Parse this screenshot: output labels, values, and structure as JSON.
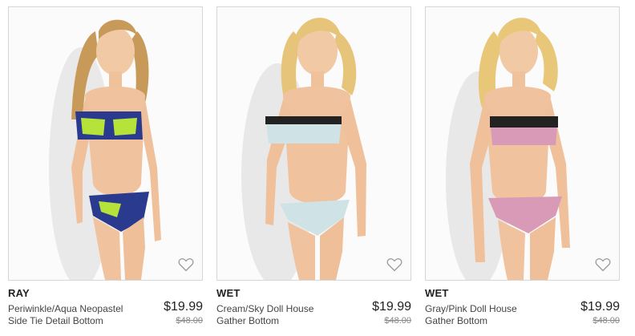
{
  "products": [
    {
      "brand": "RAY",
      "name": "Periwinkle/Aqua Neopastel Side Tie Detail Bottom",
      "price": "$19.99",
      "original_price": "$48.00",
      "hair_color": "#c89a5a",
      "swim_color": "#2a3a8f",
      "swim_accent": "#b6e33a"
    },
    {
      "brand": "WET",
      "name": "Cream/Sky Doll House Gather Bottom",
      "price": "$19.99",
      "original_price": "$48.00",
      "hair_color": "#e6c47a",
      "swim_color": "#cfe3e6",
      "swim_accent": "#222222"
    },
    {
      "brand": "WET",
      "name": "Gray/Pink Doll House Gather Bottom",
      "price": "$19.99",
      "original_price": "$48.00",
      "hair_color": "#e8c878",
      "swim_color": "#d99ab7",
      "swim_accent": "#222222"
    }
  ],
  "icons": {
    "wishlist": "heart-outline-icon"
  }
}
